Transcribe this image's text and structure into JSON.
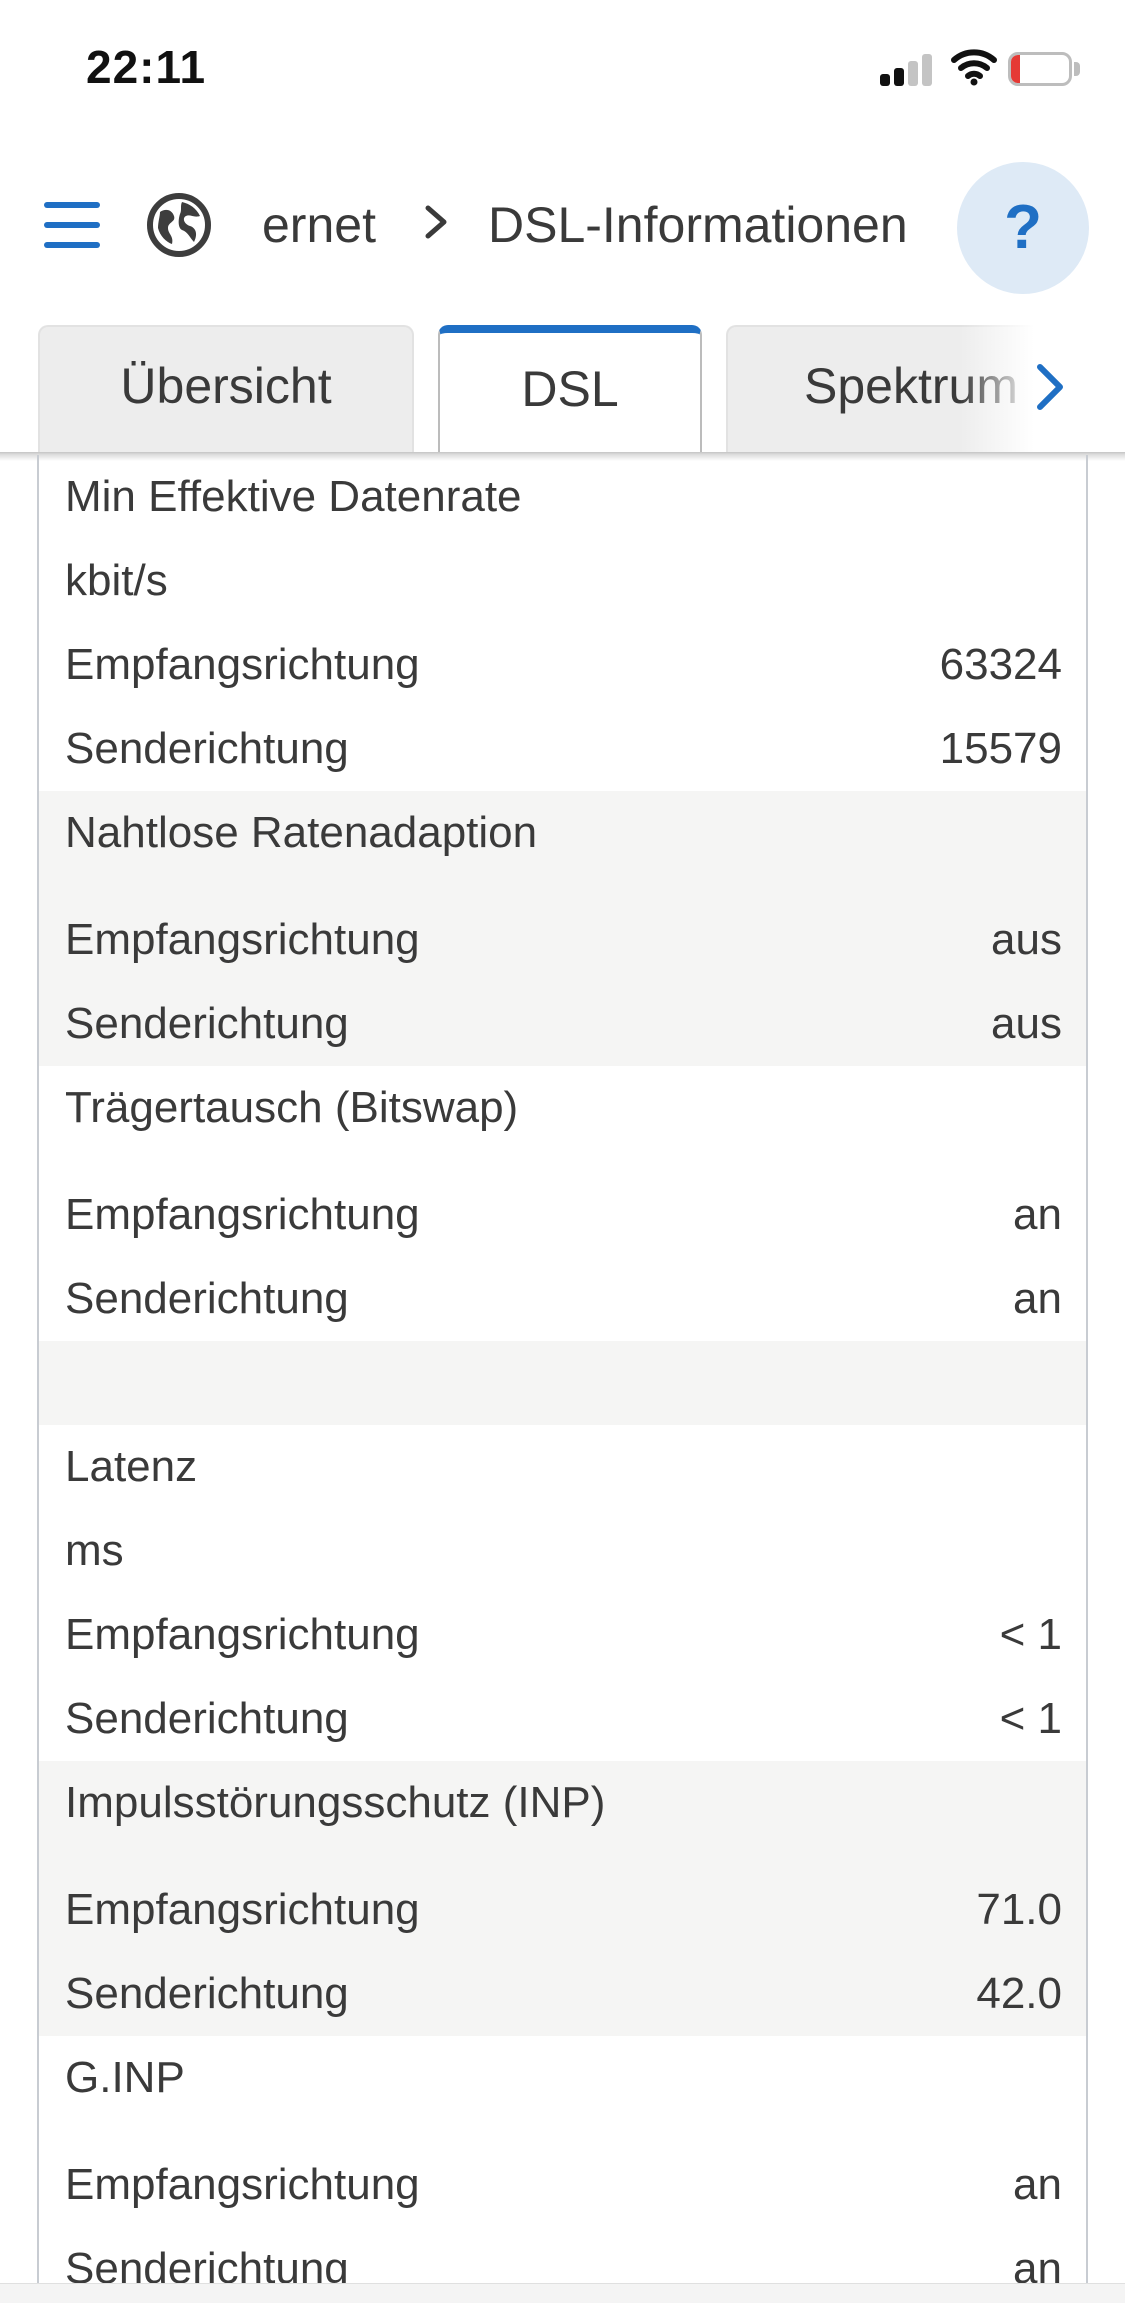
{
  "status_bar": {
    "time": "22:11",
    "battery_level": "15",
    "icons": [
      "signal-icon",
      "wifi-icon",
      "battery-icon"
    ]
  },
  "header": {
    "breadcrumb_root": "ernet",
    "breadcrumb_current": "DSL-Informationen",
    "help_label": "?",
    "icons": [
      "menu-icon",
      "globe-icon",
      "chevron-right-icon"
    ]
  },
  "tabs": [
    {
      "label": "Übersicht",
      "active": false
    },
    {
      "label": "DSL",
      "active": true
    },
    {
      "label": "Spektrum",
      "active": false
    }
  ],
  "accent_color": "#1f6fc4",
  "sections": {
    "min_rate": {
      "title": "Min Effektive Datenrate",
      "unit": "kbit/s",
      "rows": [
        {
          "label": "Empfangsrichtung",
          "value": "63324"
        },
        {
          "label": "Senderichtung",
          "value": "15579"
        }
      ]
    },
    "seamless": {
      "title": "Nahtlose Ratenadaption",
      "rows": [
        {
          "label": "Empfangsrichtung",
          "value": "aus"
        },
        {
          "label": "Senderichtung",
          "value": "aus"
        }
      ]
    },
    "bitswap": {
      "title": "Trägertausch (Bitswap)",
      "rows": [
        {
          "label": "Empfangsrichtung",
          "value": "an"
        },
        {
          "label": "Senderichtung",
          "value": "an"
        }
      ]
    },
    "latency": {
      "title": "Latenz",
      "unit": "ms",
      "rows": [
        {
          "label": "Empfangsrichtung",
          "value": "< 1"
        },
        {
          "label": "Senderichtung",
          "value": "< 1"
        }
      ]
    },
    "inp": {
      "title": "Impulsstörungsschutz (INP)",
      "rows": [
        {
          "label": "Empfangsrichtung",
          "value": "71.0"
        },
        {
          "label": "Senderichtung",
          "value": "42.0"
        }
      ]
    },
    "ginp": {
      "title": "G.INP",
      "rows": [
        {
          "label": "Empfangsrichtung",
          "value": "an"
        },
        {
          "label": "Senderichtung",
          "value": "an"
        }
      ]
    }
  }
}
